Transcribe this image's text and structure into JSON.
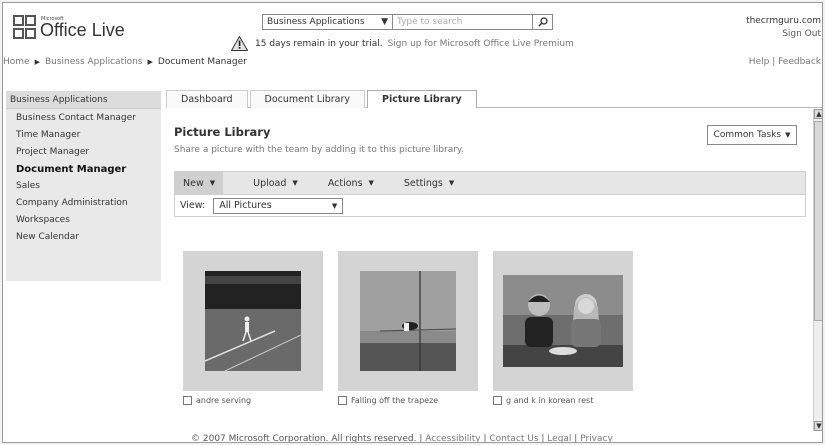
{
  "header": {
    "logo_microsoft": "Microsoft",
    "logo_name": "Office Live",
    "search_category": "Business Applications",
    "search_placeholder": "Type to search",
    "user": "thecrmguru.com",
    "signout": "Sign Out",
    "trial_text": "15 days remain in your trial.",
    "trial_link": "Sign up for Microsoft Office Live Premium"
  },
  "breadcrumb": {
    "home": "Home",
    "section": "Business Applications",
    "current": "Document Manager"
  },
  "help_links": {
    "help": "Help",
    "separator": "|",
    "feedback": "Feedback"
  },
  "sidebar": {
    "heading": "Business Applications",
    "items": [
      {
        "label": "Business Contact Manager"
      },
      {
        "label": "Time Manager"
      },
      {
        "label": "Project Manager"
      },
      {
        "label": "Document Manager"
      },
      {
        "label": "Sales"
      },
      {
        "label": "Company Administration"
      },
      {
        "label": "Workspaces"
      },
      {
        "label": "New Calendar"
      }
    ]
  },
  "tabs": [
    {
      "label": "Dashboard"
    },
    {
      "label": "Document Library"
    },
    {
      "label": "Picture Library"
    }
  ],
  "main": {
    "title": "Picture Library",
    "subtitle": "Share a picture with the team by adding it to this picture library.",
    "common_tasks": "Common Tasks",
    "toolbar": {
      "new": "New",
      "upload": "Upload",
      "actions": "Actions",
      "settings": "Settings"
    },
    "view_label": "View:",
    "view_value": "All Pictures",
    "pictures": [
      {
        "caption": "andre serving"
      },
      {
        "caption": "Falling off the trapeze"
      },
      {
        "caption": "g and k in korean rest"
      }
    ]
  },
  "footer": {
    "copyright": "© 2007 Microsoft Corporation. All rights reserved.",
    "accessibility": "Accessibility",
    "contact": "Contact Us",
    "legal": "Legal",
    "privacy": "Privacy"
  },
  "colors": {
    "sidebar_bg": "#e9e9e9",
    "toolbar_bg": "#e6e6e6",
    "frame_border": "#9a9a9a"
  },
  "icons": [
    "office-live-logo-icon",
    "dropdown-caret-icon",
    "search-icon",
    "warning-icon",
    "breadcrumb-arrow-icon",
    "scroll-up-icon",
    "scroll-down-icon"
  ]
}
